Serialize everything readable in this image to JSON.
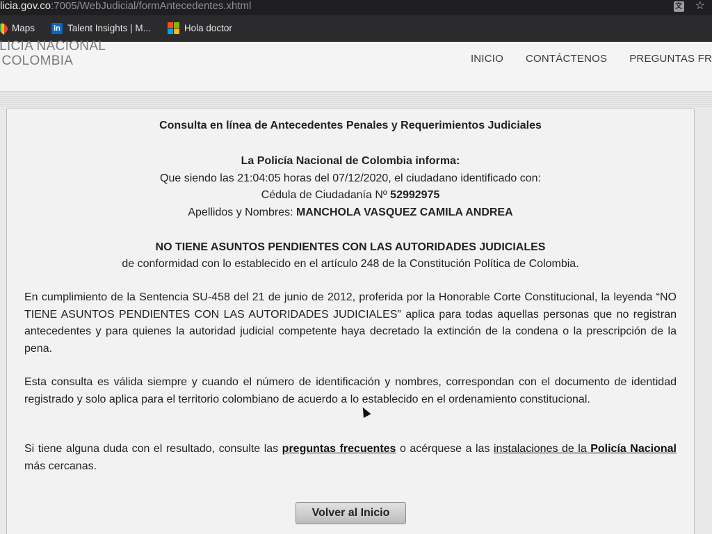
{
  "browser": {
    "url_host": "licia.gov.co",
    "url_path": ":7005/WebJudicial/formAntecedentes.xhtml",
    "bookmarks": [
      {
        "label": "Maps",
        "icon": "maps-icon"
      },
      {
        "label": "Talent Insights | M...",
        "icon": "linkedin-icon"
      },
      {
        "label": "Hola doctor",
        "icon": "microsoft-icon"
      }
    ]
  },
  "header": {
    "brand_line1": "OLICIA NACIONAL",
    "brand_line2": "E COLOMBIA",
    "nav": [
      "INICIO",
      "CONTÁCTENOS",
      "PREGUNTAS FR"
    ]
  },
  "result": {
    "title": "Consulta en línea de Antecedentes Penales y Requerimientos Judiciales",
    "informa": "La Policía Nacional de Colombia informa:",
    "line_time_prefix": "Que siendo las ",
    "time": "21:04:05",
    "line_time_mid": " horas del ",
    "date": "07/12/2020",
    "line_time_suffix": ", el ciudadano identificado con:",
    "id_label": "Cédula de Ciudadanía Nº ",
    "id_number": "52992975",
    "name_label": "Apellidos y Nombres: ",
    "name": "MANCHOLA VASQUEZ CAMILA ANDREA",
    "verdict": "NO TIENE ASUNTOS PENDIENTES CON LAS AUTORIDADES JUDICIALES",
    "verdict_basis": "de conformidad con lo establecido en el artículo 248 de la Constitución Política de Colombia.",
    "paragraph1": "En cumplimiento de la Sentencia SU-458 del 21 de junio de 2012, proferida por la Honorable Corte Constitucional, la leyenda “NO TIENE ASUNTOS PENDIENTES CON LAS AUTORIDADES JUDICIALES” aplica para todas aquellas personas que no registran antecedentes y para quienes la autoridad judicial competente haya decretado la extinción de la condena o la prescripción de la pena.",
    "paragraph2": "Esta consulta es válida siempre y cuando el número de identificación y nombres, correspondan con el documento de identidad registrado y solo aplica para el territorio colombiano de acuerdo a lo establecido en el ordenamiento constitucional.",
    "p3_prefix": "Si tiene alguna duda con el resultado, consulte las ",
    "p3_link1": "preguntas frecuentes",
    "p3_mid": " o acérquese a las ",
    "p3_link2_a": "instalaciones de la ",
    "p3_link2_b": "Policía Nacional",
    "p3_suffix": " más cercanas.",
    "back_button": "Volver al Inicio"
  }
}
